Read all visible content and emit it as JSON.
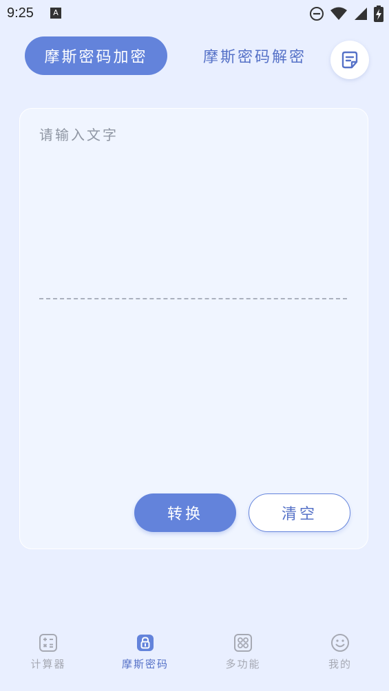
{
  "status": {
    "time": "9:25",
    "notif_icon": "a-icon",
    "icons": [
      "dnd-icon",
      "wifi-icon",
      "signal-icon",
      "battery-charging-icon"
    ]
  },
  "tabs": {
    "encrypt_label": "摩斯密码加密",
    "decrypt_label": "摩斯密码解密"
  },
  "history_icon": "note-icon",
  "editor": {
    "placeholder": "请输入文字",
    "input_value": "",
    "output_value": ""
  },
  "actions": {
    "convert_label": "转换",
    "clear_label": "清空"
  },
  "nav": {
    "items": [
      {
        "label": "计算器",
        "icon": "calculator-icon",
        "active": false
      },
      {
        "label": "摩斯密码",
        "icon": "lock-icon",
        "active": true
      },
      {
        "label": "多功能",
        "icon": "grid-icon",
        "active": false
      },
      {
        "label": "我的",
        "icon": "smile-icon",
        "active": false
      }
    ]
  },
  "colors": {
    "background": "#e9efff",
    "accent": "#6383db",
    "card": "#f0f5ff",
    "inactive_text": "#a6a9b3"
  }
}
